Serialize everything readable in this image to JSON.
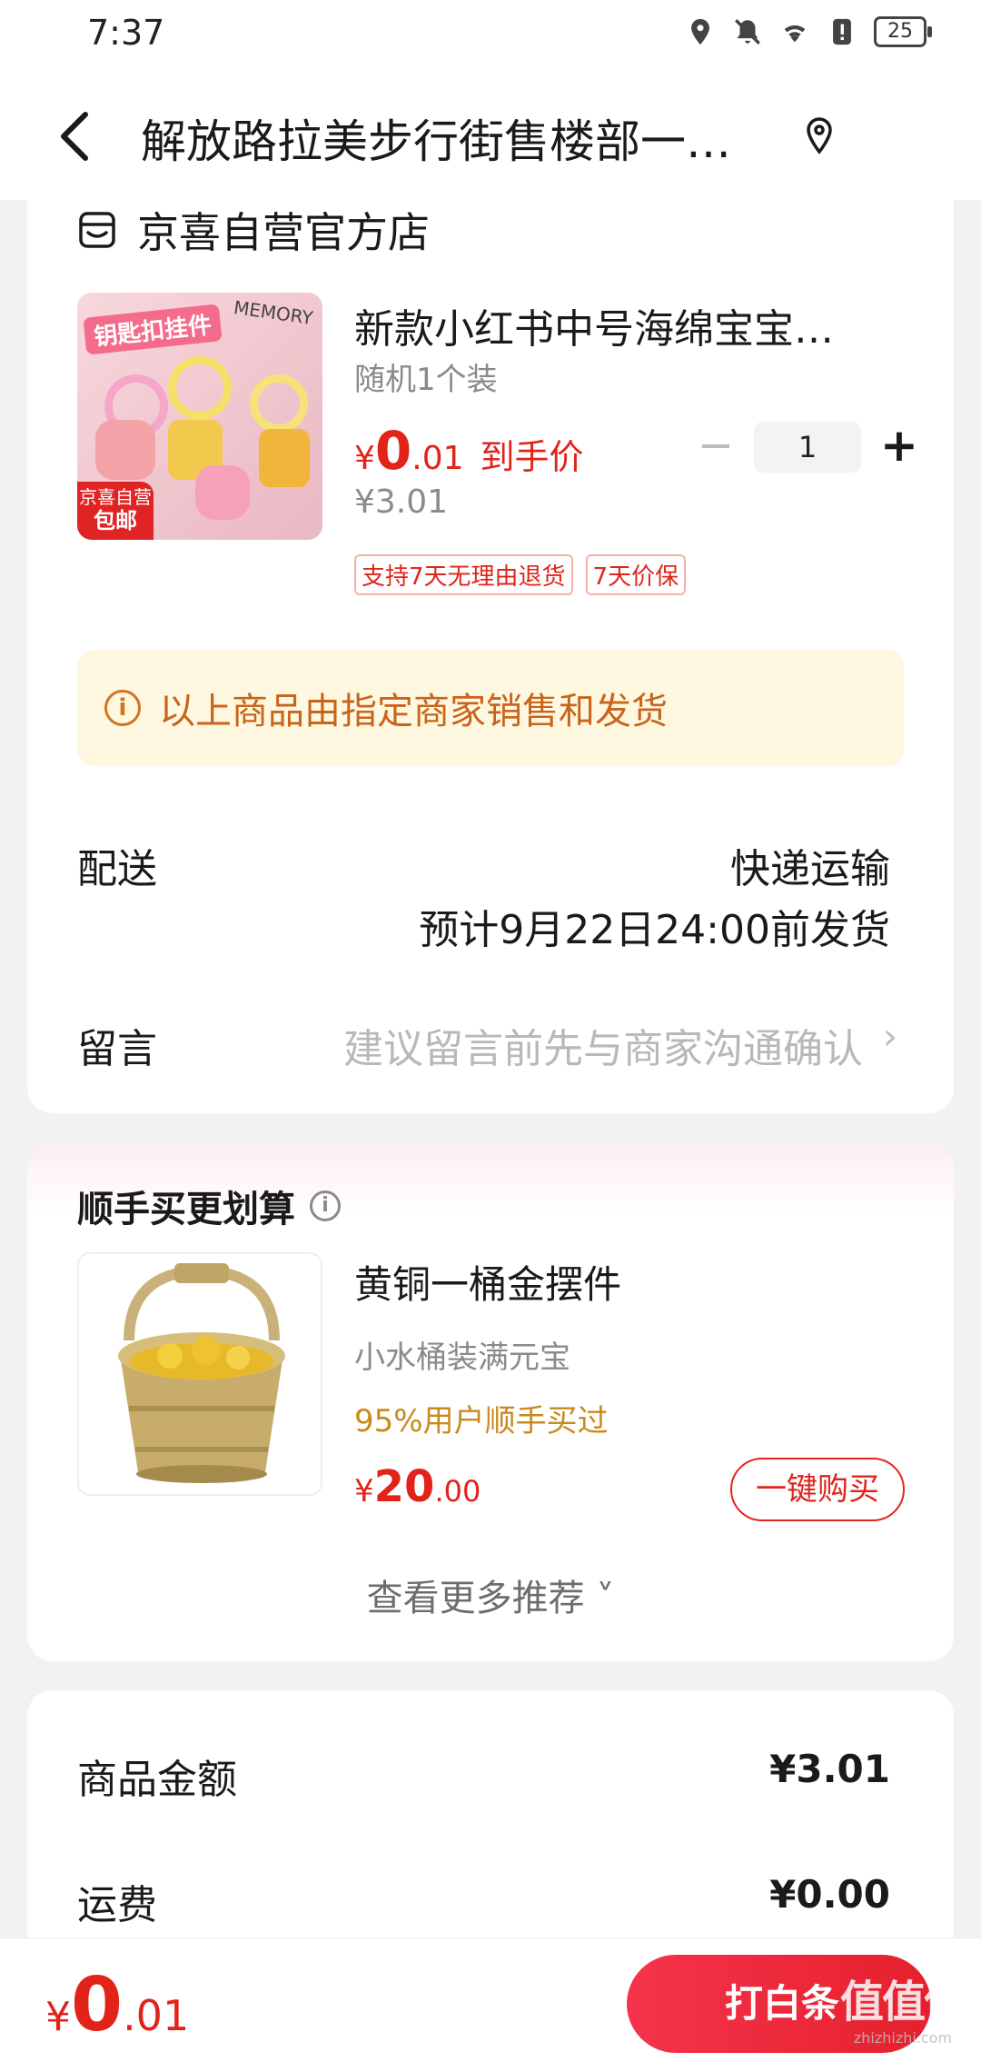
{
  "status_bar": {
    "time": "7:37",
    "battery": "25",
    "icons": [
      "location-icon",
      "mute-icon",
      "wifi-icon",
      "alert-icon",
      "battery-icon"
    ]
  },
  "navbar": {
    "title": "解放路拉美步行街售楼部一…",
    "back_icon": "chevron-left-icon",
    "location_icon": "location-pin-icon"
  },
  "store": {
    "name": "京喜自营官方店"
  },
  "product": {
    "title": "新款小红书中号海绵宝宝…",
    "spec": "随机1个装",
    "price_currency": "¥",
    "price_int": "0",
    "price_dec": ".01",
    "price_tag": "到手价",
    "original_price": "¥3.01",
    "quantity": "1",
    "minus": "−",
    "plus": "+",
    "badges": [
      "支持7天无理由退货",
      "7天价保"
    ],
    "image_label": "钥匙扣挂件",
    "image_text": "MEMORY",
    "image_badge_top": "京喜自营",
    "image_badge_bottom": "包邮"
  },
  "notice": {
    "icon": "i",
    "text": "以上商品由指定商家销售和发货"
  },
  "delivery": {
    "label": "配送",
    "method": "快递运输",
    "eta": "预计9月22日24:00前发货"
  },
  "message": {
    "label": "留言",
    "placeholder": "建议留言前先与商家沟通确认",
    "chevron": "›"
  },
  "recommend": {
    "title": "顺手买更划算",
    "info_icon": "i",
    "item": {
      "name": "黄铜一桶金摆件",
      "desc": "小水桶装满元宝",
      "popularity": "95%用户顺手买过",
      "price_currency": "¥",
      "price_int": "20",
      "price_dec": ".00",
      "buy_label": "一键购买"
    },
    "more": "查看更多推荐 ˅"
  },
  "summary": {
    "rows": [
      {
        "label": "商品金额",
        "value": "¥3.01"
      },
      {
        "label": "运费",
        "value": "¥0.00"
      }
    ]
  },
  "bottom": {
    "total_currency": "¥",
    "total_int": "0",
    "total_dec": ".01",
    "pay_label": "打白条",
    "watermark_big": "值值值",
    "watermark_small": "zhizhizhi.com"
  },
  "colors": {
    "accent": "#e2231a",
    "notice_bg": "#fff8e0",
    "notice_text": "#c8641b",
    "popularity": "#c98a1c"
  }
}
